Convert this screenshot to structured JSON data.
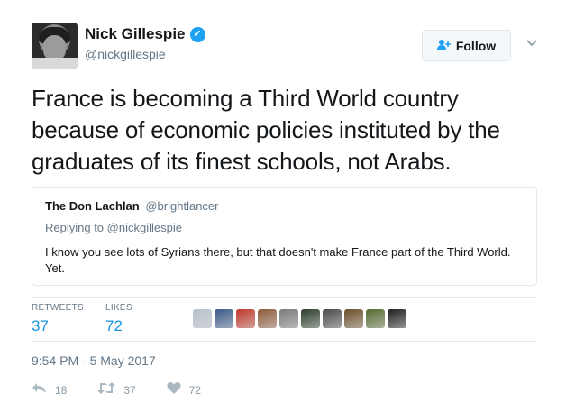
{
  "author": {
    "name": "Nick Gillespie",
    "handle": "@nickgillespie",
    "verified_icon": "verified-badge-icon"
  },
  "follow_button": {
    "label": "Follow",
    "icon": "add-user-icon"
  },
  "more_menu": {
    "icon": "chevron-down-icon"
  },
  "tweet": {
    "text": "France is becoming a Third World country because of economic policies instituted by the graduates of its finest schools, not Arabs."
  },
  "quoted": {
    "name": "The Don Lachlan",
    "handle": "@brightlancer",
    "replying_prefix": "Replying to ",
    "replying_to": "@nickgillespie",
    "text": "I know you see lots of Syrians there, but that doesn't make France part of the Third World. Yet."
  },
  "stats": {
    "retweets_label": "RETWEETS",
    "retweets": "37",
    "likes_label": "LIKES",
    "likes": "72"
  },
  "likers": [
    {
      "color": "#b8c2cc"
    },
    {
      "color": "#3a5a8a"
    },
    {
      "color": "#c0392b"
    },
    {
      "color": "#8e5b3a"
    },
    {
      "color": "#7a7a7a"
    },
    {
      "color": "#2c3e2c"
    },
    {
      "color": "#4a4a4a"
    },
    {
      "color": "#6b4f2a"
    },
    {
      "color": "#556b2f"
    },
    {
      "color": "#1e1e1e"
    }
  ],
  "timestamp": "9:54 PM - 5 May 2017",
  "actions": {
    "reply_icon": "reply-icon",
    "reply_count": "18",
    "retweet_icon": "retweet-icon",
    "retweet_count": "37",
    "like_icon": "heart-icon",
    "like_count": "72"
  },
  "colors": {
    "accent": "#1da1f2",
    "link": "#1b95e0",
    "muted": "#657786",
    "border": "#e1e8ed"
  }
}
